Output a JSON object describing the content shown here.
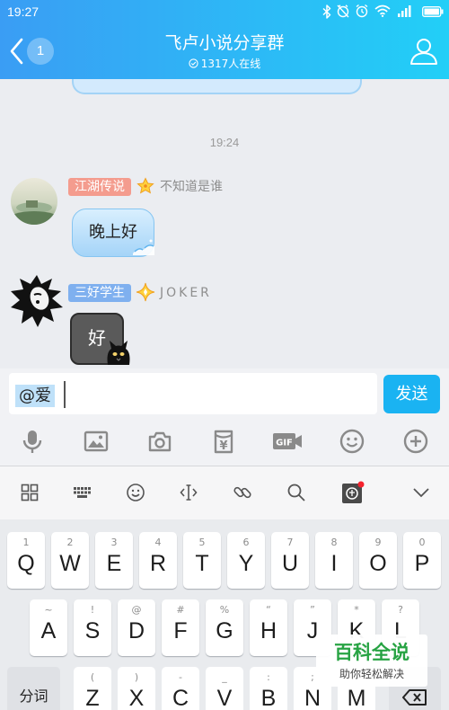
{
  "status_bar": {
    "time": "19:27",
    "icons": [
      "bluetooth-icon",
      "alarm-off-icon",
      "alarm-icon",
      "wifi-icon",
      "signal-icon",
      "battery-icon"
    ]
  },
  "header": {
    "back_badge": "1",
    "title": "飞卢小说分享群",
    "online_count": "1317人在线",
    "icons": [
      "back-arrow-icon",
      "check-circle-icon",
      "person-icon"
    ]
  },
  "chat": {
    "timestamp": "19:24",
    "messages": [
      {
        "title_badge": "江湖传说",
        "badge_icon": "star-icon",
        "sender": "不知道是谁",
        "text": "晚上好"
      },
      {
        "title_badge": "三好学生",
        "badge_icon": "sparkle-icon",
        "sender": "JOKER",
        "text": "好"
      }
    ]
  },
  "composer": {
    "mention": "@爱",
    "send_label": "发送"
  },
  "toolbar": {
    "icons": [
      "microphone-icon",
      "image-icon",
      "camera-icon",
      "red-packet-icon",
      "gif-icon",
      "emoji-icon",
      "plus-circle-icon"
    ],
    "red_packet_symbol": "¥",
    "gif_label": "GIF"
  },
  "keyboard_toolbar": {
    "icons": [
      "grid-icon",
      "keyboard-icon",
      "smiley-icon",
      "cursor-move-icon",
      "link-icon",
      "search-icon",
      "sticker-icon",
      "chevron-down-icon"
    ]
  },
  "keyboard": {
    "rows": [
      [
        {
          "key": "Q",
          "hint": "1"
        },
        {
          "key": "W",
          "hint": "2"
        },
        {
          "key": "E",
          "hint": "3"
        },
        {
          "key": "R",
          "hint": "4"
        },
        {
          "key": "T",
          "hint": "5"
        },
        {
          "key": "Y",
          "hint": "6"
        },
        {
          "key": "U",
          "hint": "7"
        },
        {
          "key": "I",
          "hint": "8"
        },
        {
          "key": "O",
          "hint": "9"
        },
        {
          "key": "P",
          "hint": "0"
        }
      ],
      [
        {
          "key": "A",
          "hint": "~"
        },
        {
          "key": "S",
          "hint": "!"
        },
        {
          "key": "D",
          "hint": "@"
        },
        {
          "key": "F",
          "hint": "#"
        },
        {
          "key": "G",
          "hint": "%"
        },
        {
          "key": "H",
          "hint": "“"
        },
        {
          "key": "J",
          "hint": "”"
        },
        {
          "key": "K",
          "hint": "*"
        },
        {
          "key": "L",
          "hint": "?"
        }
      ],
      [
        {
          "key": "Z",
          "hint": "("
        },
        {
          "key": "X",
          "hint": ")"
        },
        {
          "key": "C",
          "hint": "-"
        },
        {
          "key": "V",
          "hint": "_"
        },
        {
          "key": "B",
          "hint": ":"
        },
        {
          "key": "N",
          "hint": ";"
        },
        {
          "key": "M",
          "hint": ""
        }
      ]
    ],
    "segment_label": "分词",
    "backspace_icon": "backspace-icon"
  },
  "watermark": {
    "title": "百科全说",
    "subtitle": "助你轻松解决"
  },
  "colors": {
    "header_start": "#3a9df4",
    "header_end": "#22cff7",
    "send_button": "#1ab3f2",
    "badge_jianghu": "#f49c8e",
    "badge_sanhao": "#7fb0ef",
    "unread_dot": "#f5222d",
    "watermark_green": "#27a343"
  }
}
